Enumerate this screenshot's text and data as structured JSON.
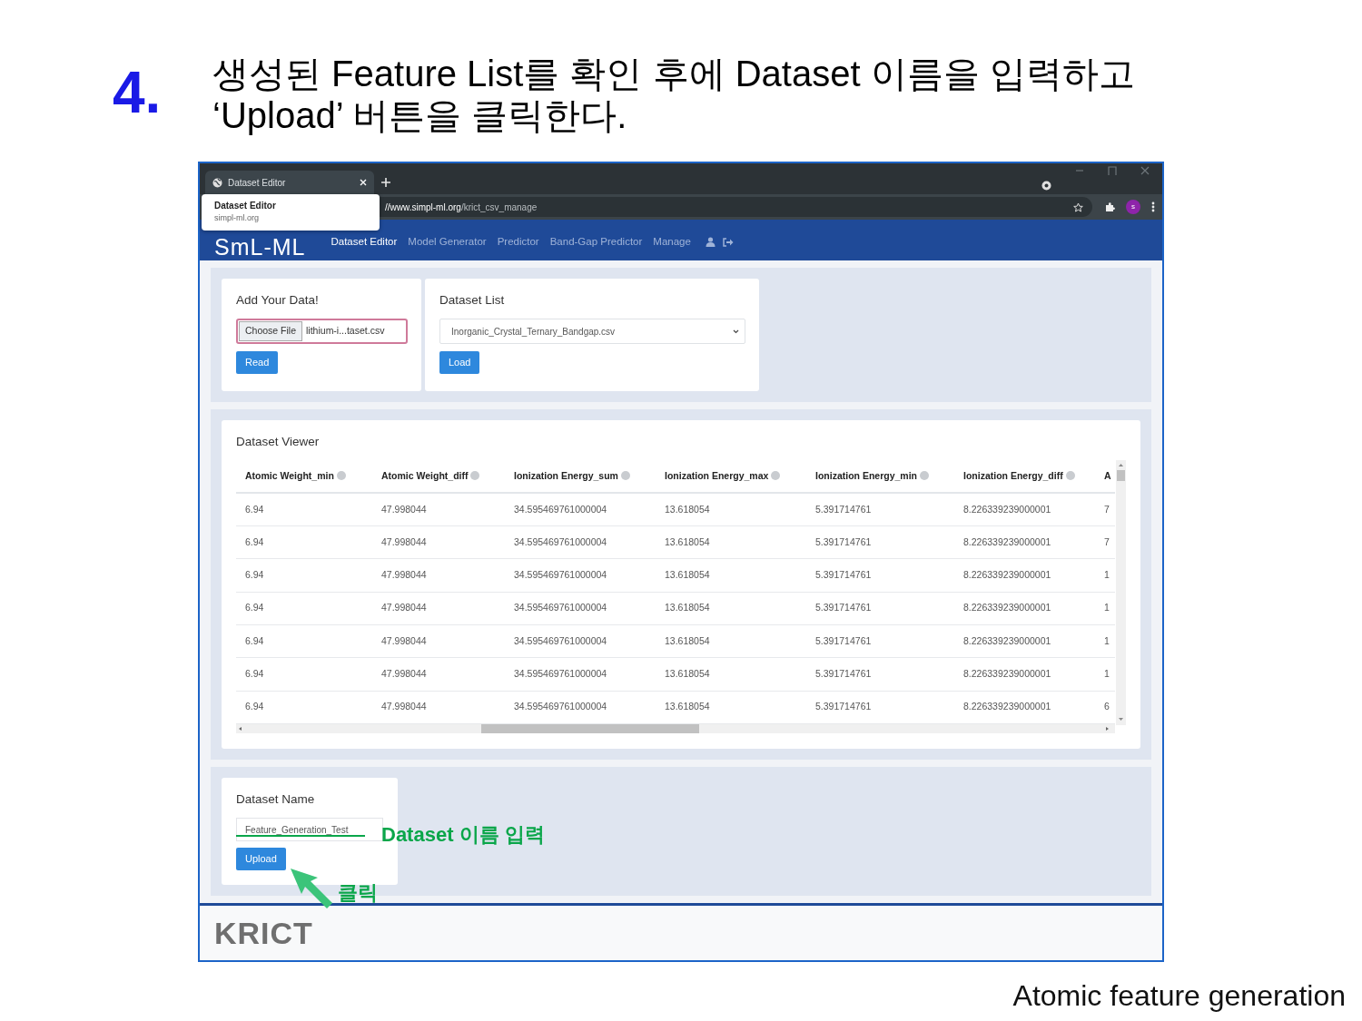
{
  "slide": {
    "step": "4.",
    "heading_lines": [
      "생성된 Feature List를 확인 후에 Dataset 이름을 입력하고",
      "‘Upload’ 버튼을 클릭한다."
    ],
    "caption": "Atomic feature generation"
  },
  "browser": {
    "tabs": [
      {
        "title": "Dataset Editor",
        "selected": true
      }
    ],
    "tab_tooltip": {
      "title": "Dataset Editor",
      "domain": "simpl-ml.org"
    },
    "url_host": "//www.simpl-ml.org",
    "url_path": "/krict_csv_manage",
    "avatar": "s"
  },
  "navbar": {
    "brand": "SmL-ML",
    "items": [
      {
        "label": "Dataset Editor",
        "selected": true
      },
      {
        "label": "Model Generator",
        "selected": false
      },
      {
        "label": "Predictor",
        "selected": false
      },
      {
        "label": "Band-Gap Predictor",
        "selected": false
      },
      {
        "label": "Manage",
        "selected": false
      }
    ]
  },
  "add_data": {
    "title": "Add Your Data!",
    "choose_button": "Choose File",
    "file_name": "lithium-i...taset.csv",
    "focused": true,
    "button": "Read"
  },
  "dataset_list": {
    "title": "Dataset List",
    "selected_option": "Inorganic_Crystal_Ternary_Bandgap.csv",
    "button": "Load"
  },
  "viewer": {
    "title": "Dataset Viewer",
    "table": {
      "columns": [
        "Atomic Weight_min",
        "Atomic Weight_diff",
        "Ionization Energy_sum",
        "Ionization Energy_max",
        "Ionization Energy_min",
        "Ionization Energy_diff",
        "A"
      ],
      "rows": [
        [
          "6.94",
          "47.998044",
          "34.595469761000004",
          "13.618054",
          "5.391714761",
          "8.226339239000001",
          "7"
        ],
        [
          "6.94",
          "47.998044",
          "34.595469761000004",
          "13.618054",
          "5.391714761",
          "8.226339239000001",
          "7"
        ],
        [
          "6.94",
          "47.998044",
          "34.595469761000004",
          "13.618054",
          "5.391714761",
          "8.226339239000001",
          "1"
        ],
        [
          "6.94",
          "47.998044",
          "34.595469761000004",
          "13.618054",
          "5.391714761",
          "8.226339239000001",
          "1"
        ],
        [
          "6.94",
          "47.998044",
          "34.595469761000004",
          "13.618054",
          "5.391714761",
          "8.226339239000001",
          "1"
        ],
        [
          "6.94",
          "47.998044",
          "34.595469761000004",
          "13.618054",
          "5.391714761",
          "8.226339239000001",
          "1"
        ],
        [
          "6.94",
          "47.998044",
          "34.595469761000004",
          "13.618054",
          "5.391714761",
          "8.226339239000001",
          "6"
        ]
      ]
    }
  },
  "dataset_name": {
    "title": "Dataset Name",
    "value": "Feature_Generation_Test",
    "button": "Upload"
  },
  "annotations": {
    "input_note": "Dataset 이름 입력",
    "click_note": "클릭"
  },
  "footer": {
    "logo": "KRICT"
  }
}
